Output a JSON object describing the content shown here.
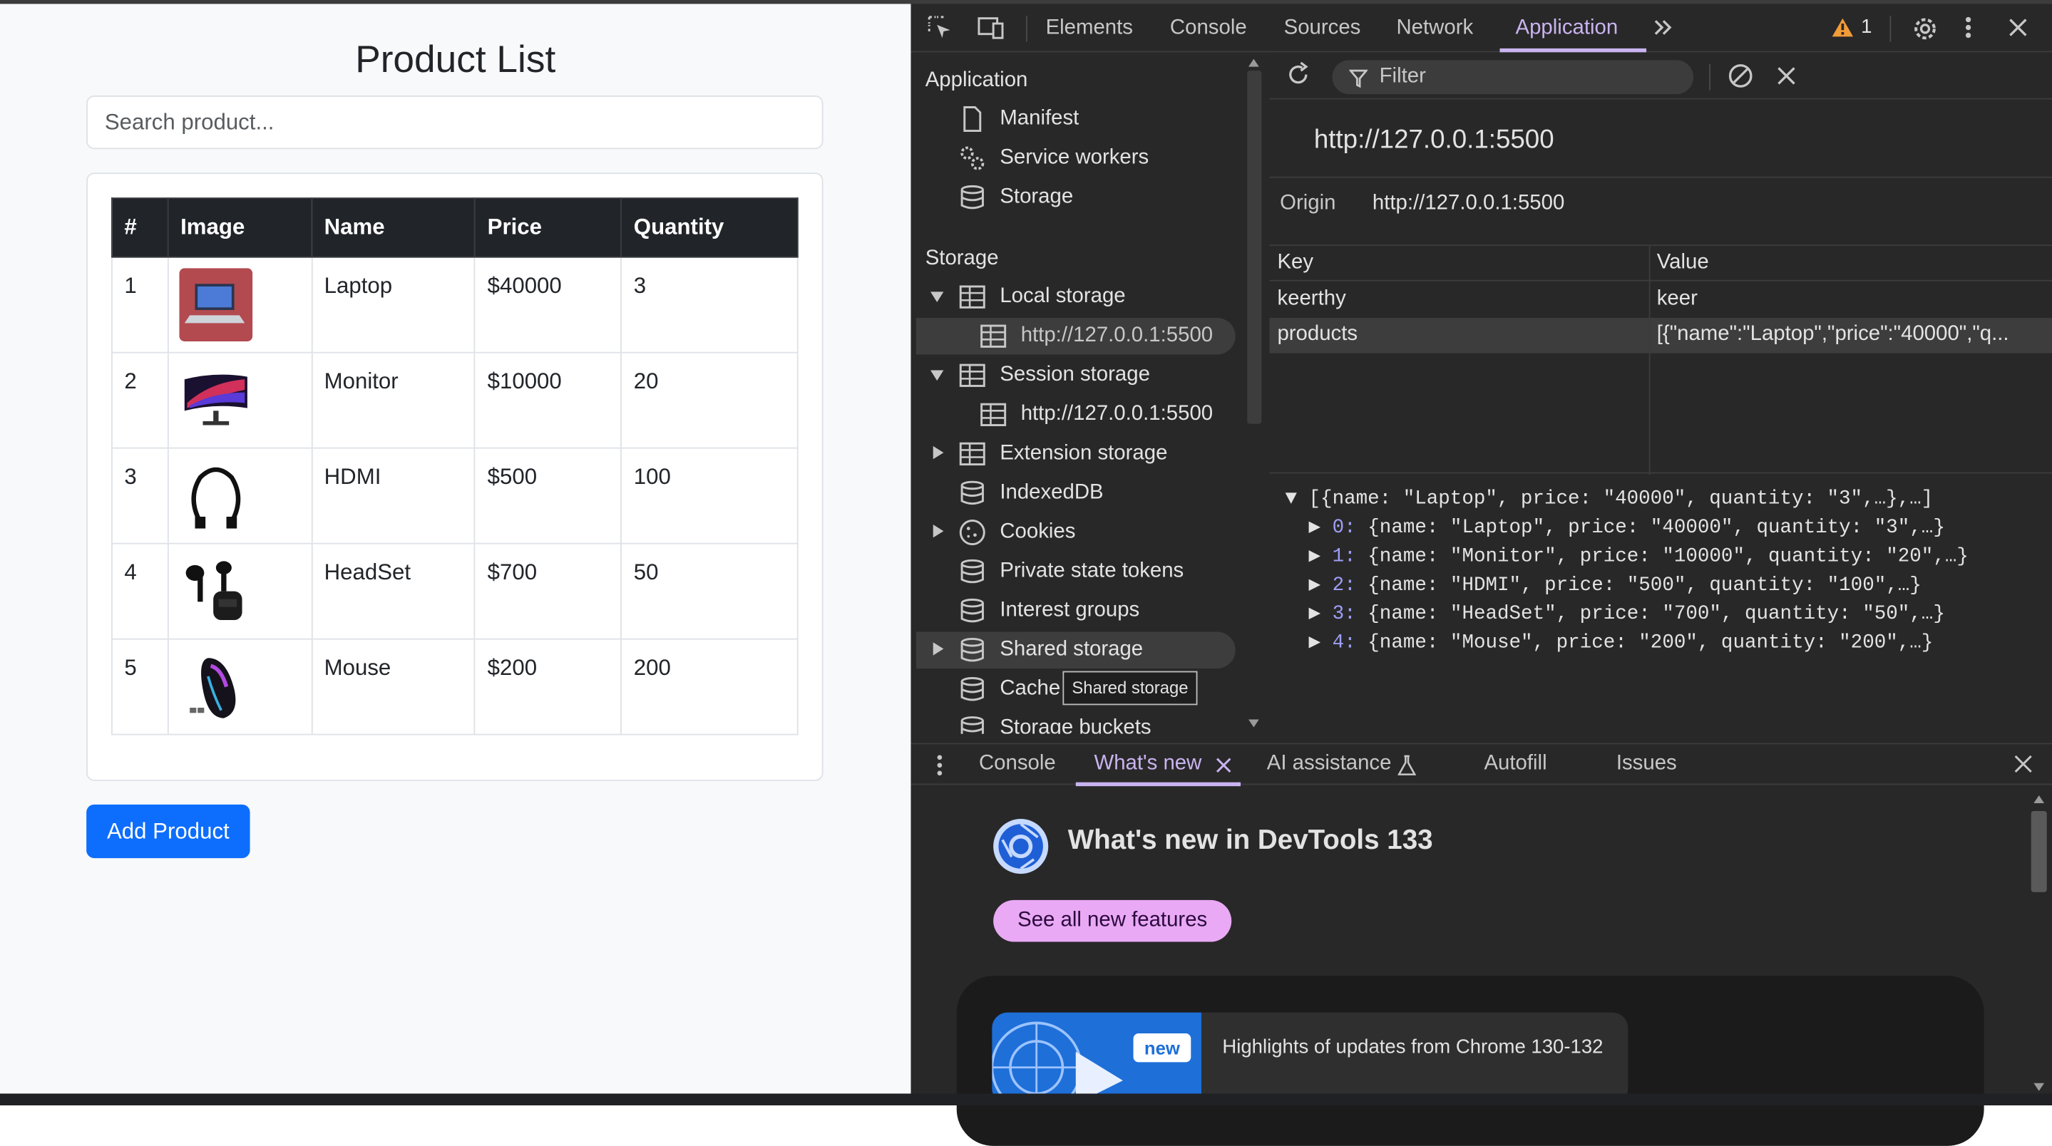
{
  "app": {
    "title": "Product List",
    "search_placeholder": "Search product...",
    "table": {
      "headers": [
        "#",
        "Image",
        "Name",
        "Price",
        "Quantity"
      ],
      "rows": [
        {
          "num": "1",
          "name": "Laptop",
          "price": "$40000",
          "qty": "3"
        },
        {
          "num": "2",
          "name": "Monitor",
          "price": "$10000",
          "qty": "20"
        },
        {
          "num": "3",
          "name": "HDMI",
          "price": "$500",
          "qty": "100"
        },
        {
          "num": "4",
          "name": "HeadSet",
          "price": "$700",
          "qty": "50"
        },
        {
          "num": "5",
          "name": "Mouse",
          "price": "$200",
          "qty": "200"
        }
      ]
    },
    "add_button": "Add Product",
    "colors": {
      "primary": "#0d6efd",
      "header_dark": "#212529"
    }
  },
  "devtools": {
    "tabs": [
      "Elements",
      "Console",
      "Sources",
      "Network",
      "Application"
    ],
    "active_tab": "Application",
    "warning_count": "1",
    "sidebar": {
      "application_header": "Application",
      "application_items": [
        "Manifest",
        "Service workers",
        "Storage"
      ],
      "storage_header": "Storage",
      "local_storage": "Local storage",
      "local_origin": "http://127.0.0.1:5500",
      "session_storage": "Session storage",
      "session_origin": "http://127.0.0.1:5500",
      "extension_storage": "Extension storage",
      "indexeddb": "IndexedDB",
      "cookies": "Cookies",
      "private_state_tokens": "Private state tokens",
      "interest_groups": "Interest groups",
      "shared_storage": "Shared storage",
      "cache": "Cache",
      "storage_buckets": "Storage buckets",
      "tooltip": "Shared storage"
    },
    "storage_view": {
      "filter_placeholder": "Filter",
      "origin_title": "http://127.0.0.1:5500",
      "origin_label": "Origin",
      "origin_value": "http://127.0.0.1:5500",
      "key_header": "Key",
      "value_header": "Value",
      "entries": [
        {
          "key": "keerthy",
          "value": "keer"
        },
        {
          "key": "products",
          "value": "[{\"name\":\"Laptop\",\"price\":\"40000\",\"q..."
        }
      ],
      "preview_root": "[{name: \"Laptop\", price: \"40000\", quantity: \"3\",…},…]",
      "preview_items": [
        {
          "idx": "0:",
          "text": "{name: \"Laptop\", price: \"40000\", quantity: \"3\",…}"
        },
        {
          "idx": "1:",
          "text": "{name: \"Monitor\", price: \"10000\", quantity: \"20\",…}"
        },
        {
          "idx": "2:",
          "text": "{name: \"HDMI\", price: \"500\", quantity: \"100\",…}"
        },
        {
          "idx": "3:",
          "text": "{name: \"HeadSet\", price: \"700\", quantity: \"50\",…}"
        },
        {
          "idx": "4:",
          "text": "{name: \"Mouse\", price: \"200\", quantity: \"200\",…}"
        }
      ]
    },
    "drawer": {
      "tabs": [
        "Console",
        "What's new",
        "AI assistance",
        "Autofill",
        "Issues"
      ],
      "active_tab": "What's new",
      "whats_new_title": "What's new in DevTools 133",
      "see_all": "See all new features",
      "new_badge": "new",
      "highlight_text": "Highlights of updates from Chrome 130-132"
    },
    "colors": {
      "bg": "#282828",
      "accent": "#c9b3f0",
      "pill": "#e9a9f5"
    }
  }
}
